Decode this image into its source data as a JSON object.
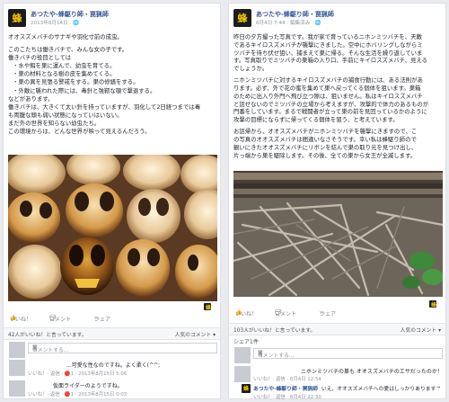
{
  "left": {
    "page_name": "あつたや-蜂駆り師・罠猟師",
    "meta": "2013年8月14日 · 🌐",
    "lines": [
      "オオスズメバチのサナギや羽化寸前の成虫。",
      "",
      "このこたちは働きバチで、みんな女の子です。",
      "働きバチの役目としては",
      "・水や餌を巣に運んで、幼虫を育てる。",
      "・巣の材料となる樹の皮を集めてくる。",
      "・巣の異を見張る警戒をする。巣の修繕をする。",
      "・外敵に襲われた際には、毒針と強靭な顎で撃退する。",
      "などがあります。",
      "働きバチは、大きくて太い針を持っていますが、羽化して2日経つまでは毒",
      "も両腹な頭も弱い状態になっていはいない。",
      "まだ外の世界を知らない幼虫たち。",
      "この環境からは、どんな世界が映って見えるんだろう。"
    ],
    "actions": {
      "like": "いいね！",
      "comment": "コメント",
      "share": "シェア"
    },
    "likes_text": "42人がいいね！と言っています。",
    "sort": "人気のコメント ▾",
    "comment_placeholder": "コメントする...",
    "comments": [
      {
        "text": "...可愛な性なのですね。よく柔く(^^;",
        "meta": "いいね！· 返信 · 🔴1 · 2013年8月15日 5:06"
      },
      {
        "text": "仮面ライダーのようですね。",
        "meta": "いいね！· 返信 · 🔴1 · 2013年8月15日 0:03"
      }
    ]
  },
  "right": {
    "page_name": "あつたや-蜂駆り師・罠猟師",
    "meta": "6月4日 7:44 · 編集済み · 🌐",
    "lines": [
      "昨日の夕方撮った写真です。我が家で育っているニホンミツバチを、天敵",
      "であるキイロスズメバチが襲撃にきました。空中にホバリングしながらミ",
      "ツバチを待ち伏せ狙い、捕まえて巣に帰る。そんな生活を繰り返していま",
      "す。写真取りでミツバチの巣箱の入り口、手前にキイロスズメバチ、見える",
      "でしょうか。",
      "",
      "ニホンミツバチに対するキイロスズメバチの捕食行動には、ある法則があ",
      "ります。必ず、外で花の蜜を集めて巣へ戻ってくる個体を狙います。巣箱",
      "のために出入り外門へ飛び立つ隙は、狙いません。私はキイロスズメバチ",
      "と話せないのでミツバチの立場から考えますが、攻撃的で体力のあるものが",
      "門番をしています。まるで戦闘者が立って巣の前を見回っているかのように",
      "攻撃の目標にならずに帰ってくる個体を狙う、と考えています。",
      "",
      "お話帰から、オオスズメバチがニホンミツバチを襲撃にきますので、こ",
      "の写真のオオスズメバチは間違いなさそうです。幸い私は蜂駆り師ので",
      "観いにきたオオスズメバチにリボンを結んで巣の取り元を見つけ出し、",
      "片っ端から巣を駆除します。その後、全ての巣から女王が全滅します。"
    ],
    "actions": {
      "like": "いいね！",
      "comment": "コメント",
      "share": "シェア"
    },
    "likes_text": "103人がいいね！と言っています。",
    "sort": "人気のコメント ▾",
    "shares_text": "シェア1件",
    "comment_placeholder": "コメントする...",
    "comments": [
      {
        "text": "ニホンミツバチの巣も オオスズメバチのエサだったのか！",
        "meta": "いいね！· 返信 · 6月4日 12:54"
      },
      {
        "author": "あつたや-蜂駆り師・罠猟師",
        "text": "いえ、オオスズメバチへの愛はしっかりあります™",
        "meta": "いいね！· 返信 · 6月4日 22:30"
      }
    ]
  }
}
